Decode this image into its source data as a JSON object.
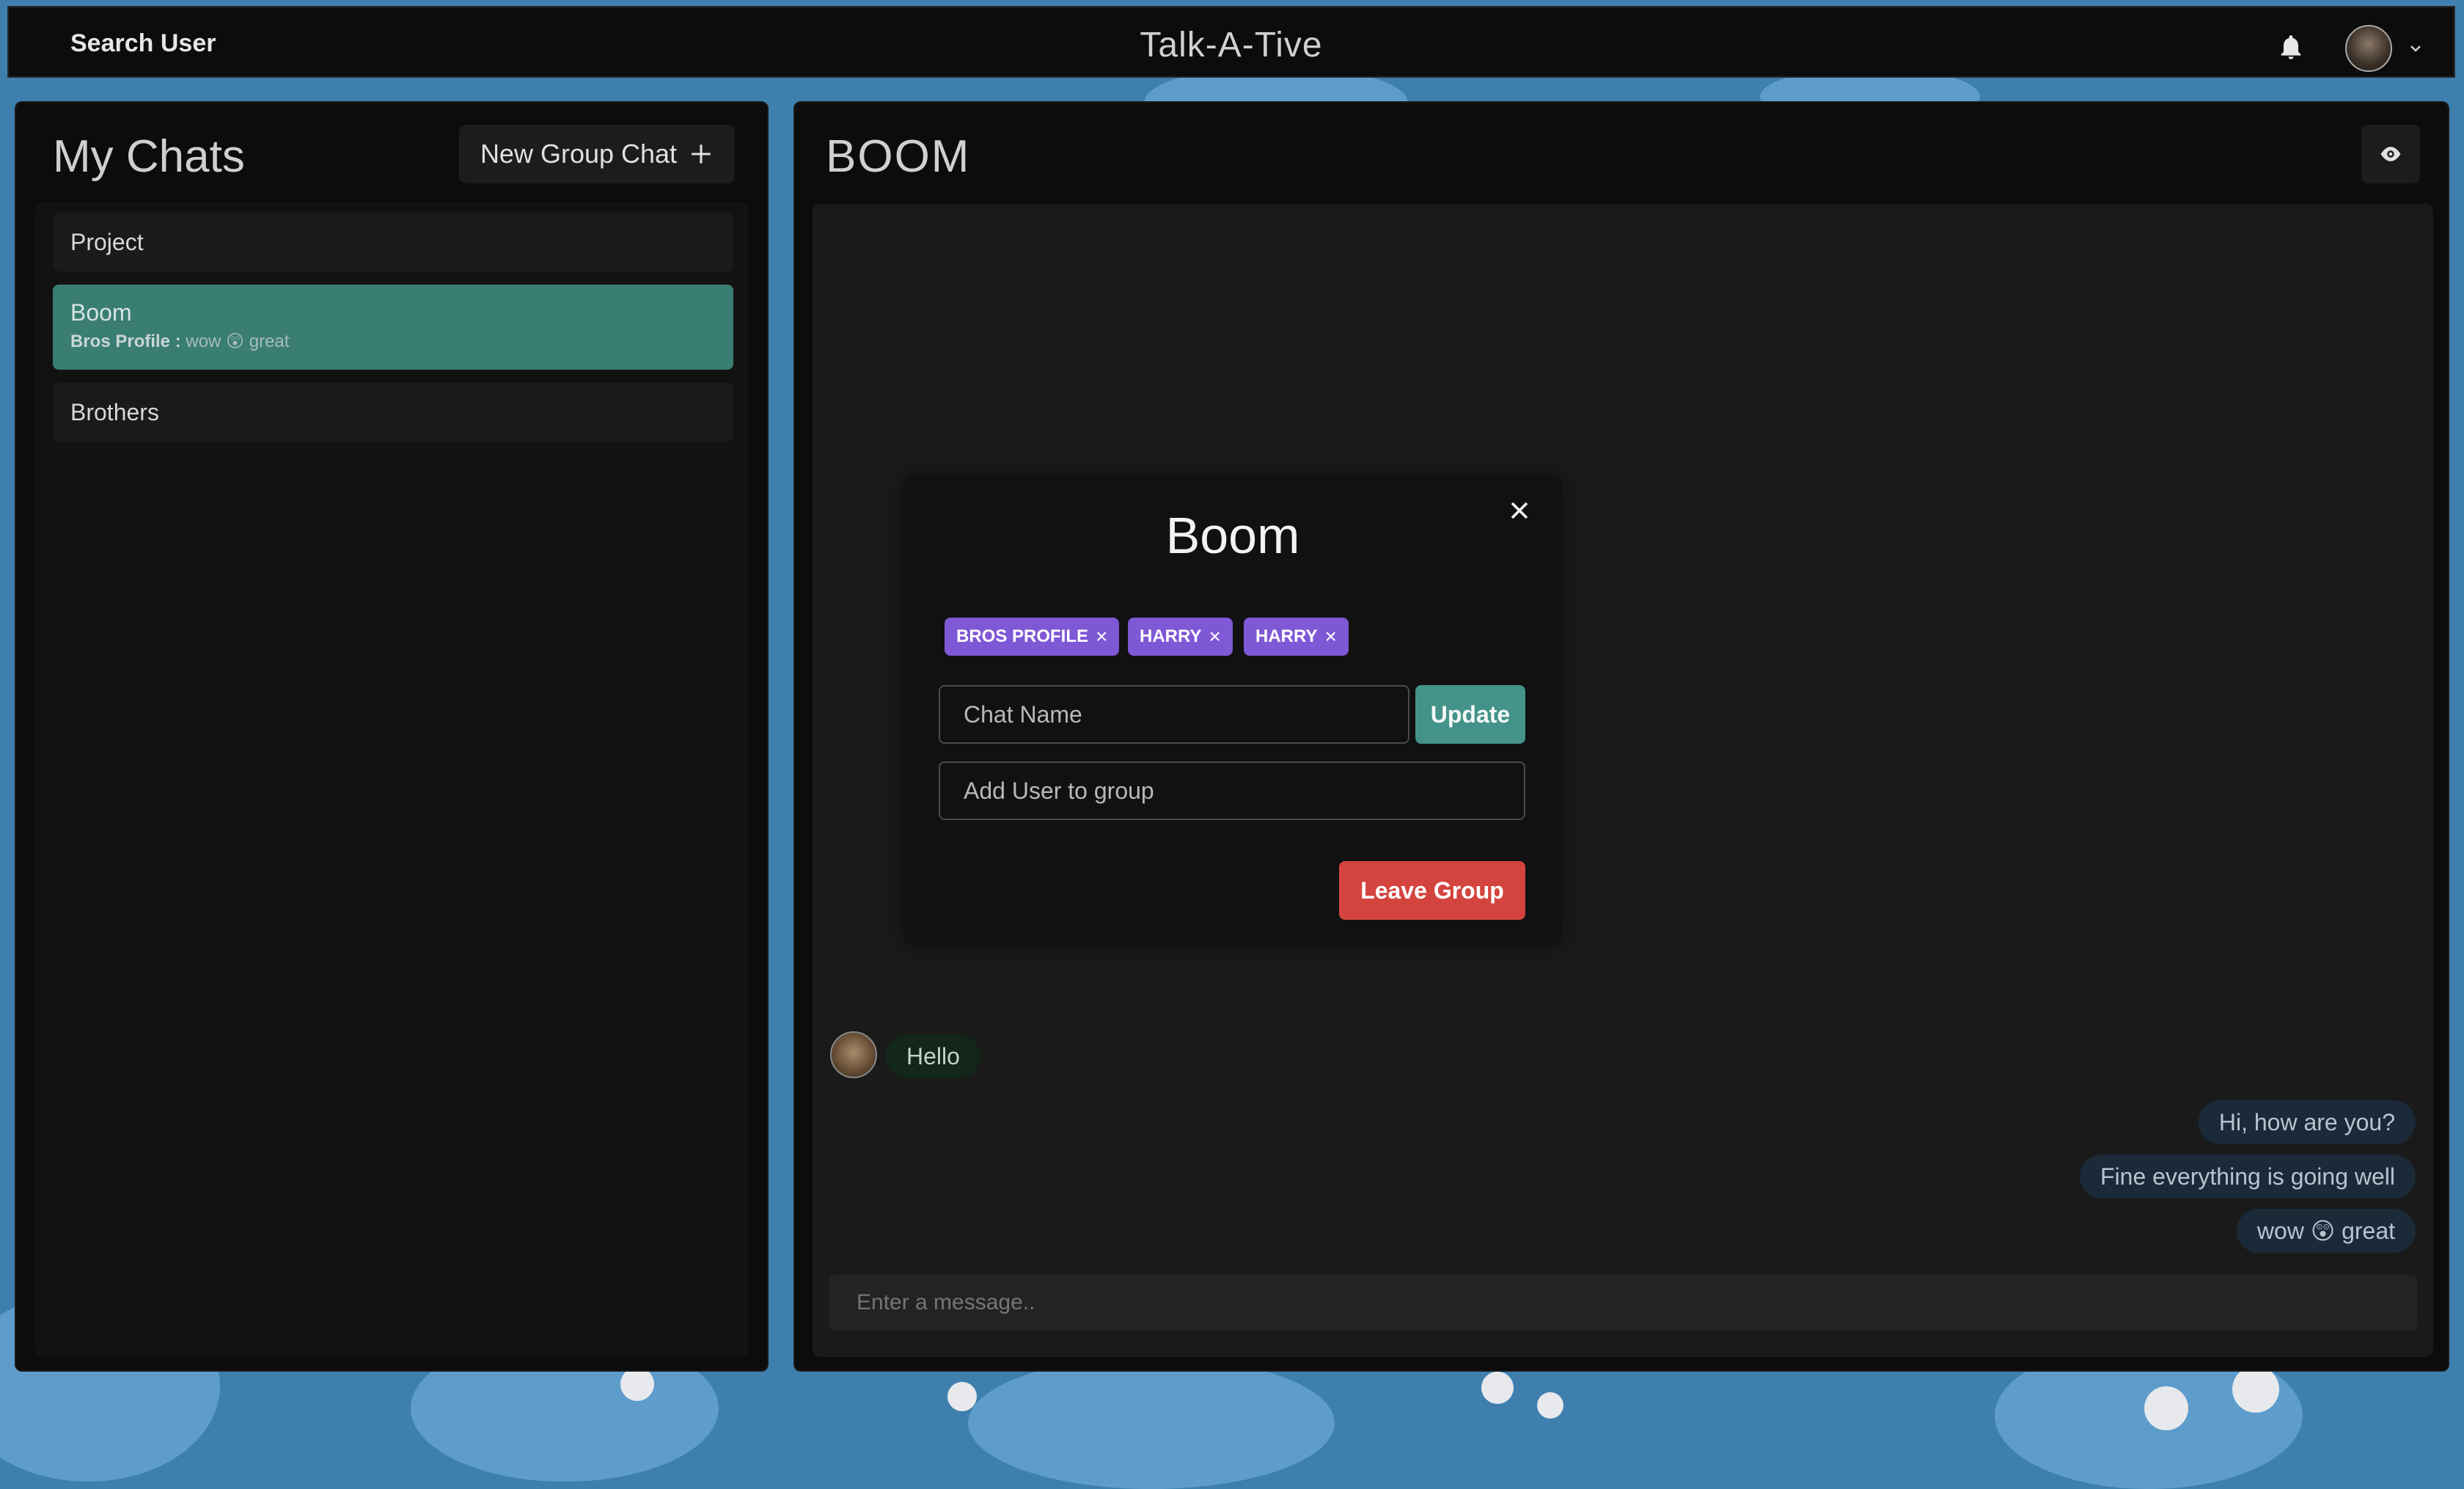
{
  "topbar": {
    "search_label": "Search User",
    "app_title": "Talk-A-Tive"
  },
  "left": {
    "title": "My Chats",
    "new_group_label": "New Group Chat",
    "chats": [
      {
        "name": "Project"
      },
      {
        "name": "Boom",
        "preview_sender": "Bros Profile :",
        "preview_text": "wow 😲 great"
      },
      {
        "name": "Brothers"
      }
    ]
  },
  "right": {
    "chat_title": "BOOM",
    "messages": [
      {
        "side": "in",
        "text": "Hello"
      },
      {
        "side": "out",
        "text": "Hi, how are you?"
      },
      {
        "side": "out",
        "text": "Fine everything is going well"
      },
      {
        "side": "out",
        "text": "wow 😲 great"
      }
    ],
    "input_placeholder": "Enter a message.."
  },
  "modal": {
    "title": "Boom",
    "tags": [
      "BROS PROFILE",
      "HARRY",
      "HARRY"
    ],
    "chat_name_placeholder": "Chat Name",
    "update_label": "Update",
    "add_user_placeholder": "Add User to group",
    "leave_label": "Leave Group"
  },
  "colors": {
    "accent_teal": "#44938a",
    "tag_purple": "#7f58d6",
    "danger_red": "#d4443f",
    "background_blue": "#3f7fae"
  },
  "icons": [
    "bell-icon",
    "avatar",
    "chevron-down-icon",
    "plus-icon",
    "eye-icon",
    "close-icon",
    "tag-remove-icon"
  ]
}
